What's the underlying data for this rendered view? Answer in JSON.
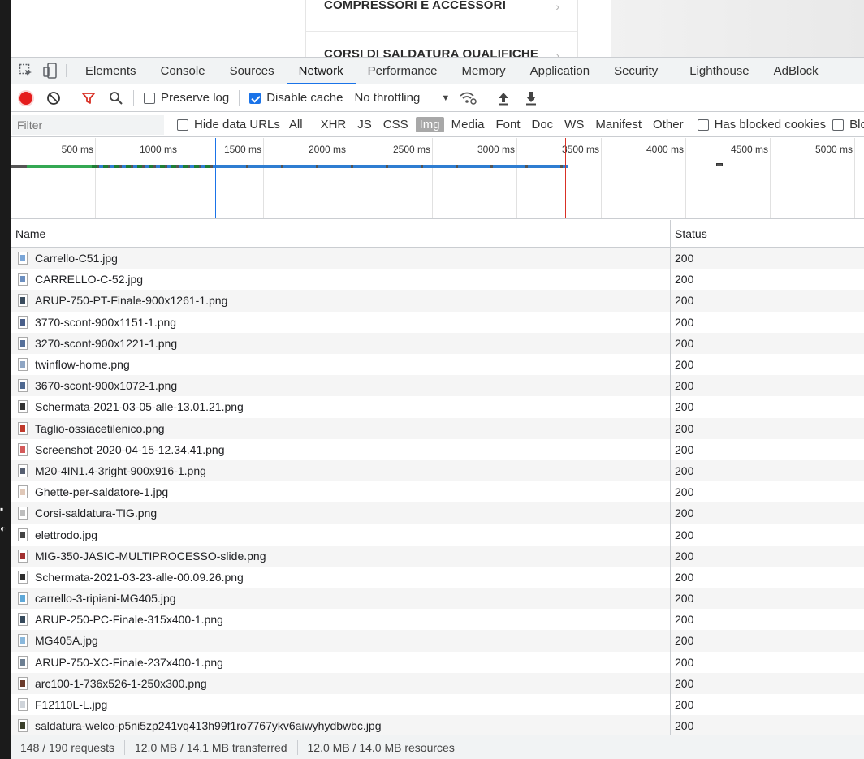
{
  "page": {
    "menu_items": [
      "COMPRESSORI E ACCESSORI",
      "CORSI DI SALDATURA QUALIFICHE"
    ]
  },
  "tabs": [
    "Elements",
    "Console",
    "Sources",
    "Network",
    "Performance",
    "Memory",
    "Application",
    "Security",
    "Lighthouse",
    "AdBlock"
  ],
  "active_tab": "Network",
  "toolbar": {
    "preserve_log": "Preserve log",
    "preserve_log_checked": false,
    "disable_cache": "Disable cache",
    "disable_cache_checked": true,
    "throttling": "No throttling"
  },
  "filterbar": {
    "placeholder": "Filter",
    "hide_data_urls": "Hide data URLs",
    "types": [
      "All",
      "XHR",
      "JS",
      "CSS",
      "Img",
      "Media",
      "Font",
      "Doc",
      "WS",
      "Manifest",
      "Other"
    ],
    "active_type": "Img",
    "has_blocked_cookies": "Has blocked cookies",
    "blocked_truncated": "Bloc"
  },
  "overview": {
    "ticks": [
      "500 ms",
      "1000 ms",
      "1500 ms",
      "2000 ms",
      "2500 ms",
      "3000 ms",
      "3500 ms",
      "4000 ms",
      "4500 ms",
      "5000 ms"
    ]
  },
  "table": {
    "headers": {
      "name": "Name",
      "status": "Status"
    },
    "rows": [
      {
        "name": "Carrello-C51.jpg",
        "status": "200",
        "color": "#7aa6d8"
      },
      {
        "name": "CARRELLO-C-52.jpg",
        "status": "200",
        "color": "#6c8fc0"
      },
      {
        "name": "ARUP-750-PT-Finale-900x1261-1.png",
        "status": "200",
        "color": "#3a4c5e"
      },
      {
        "name": "3770-scont-900x1151-1.png",
        "status": "200",
        "color": "#4a5f8a"
      },
      {
        "name": "3270-scont-900x1221-1.png",
        "status": "200",
        "color": "#56709a"
      },
      {
        "name": "twinflow-home.png",
        "status": "200",
        "color": "#8fa6c4"
      },
      {
        "name": "3670-scont-900x1072-1.png",
        "status": "200",
        "color": "#4e6890"
      },
      {
        "name": "Schermata-2021-03-05-alle-13.01.21.png",
        "status": "200",
        "color": "#333333"
      },
      {
        "name": "Taglio-ossiacetilenico.png",
        "status": "200",
        "color": "#c0392b"
      },
      {
        "name": "Screenshot-2020-04-15-12.34.41.png",
        "status": "200",
        "color": "#d45a5a"
      },
      {
        "name": "M20-4IN1.4-3right-900x916-1.png",
        "status": "200",
        "color": "#555e70"
      },
      {
        "name": "Ghette-per-saldatore-1.jpg",
        "status": "200",
        "color": "#e0c8b8"
      },
      {
        "name": "Corsi-saldatura-TIG.png",
        "status": "200",
        "color": "#bdbdbd"
      },
      {
        "name": "elettrodo.jpg",
        "status": "200",
        "color": "#444444"
      },
      {
        "name": "MIG-350-JASIC-MULTIPROCESSO-slide.png",
        "status": "200",
        "color": "#a23030"
      },
      {
        "name": "Schermata-2021-03-23-alle-00.09.26.png",
        "status": "200",
        "color": "#2e2e2e"
      },
      {
        "name": "carrello-3-ripiani-MG405.jpg",
        "status": "200",
        "color": "#5fa8d8"
      },
      {
        "name": "ARUP-250-PC-Finale-315x400-1.png",
        "status": "200",
        "color": "#364a5c"
      },
      {
        "name": "MG405A.jpg",
        "status": "200",
        "color": "#8ab8dc"
      },
      {
        "name": "ARUP-750-XC-Finale-237x400-1.png",
        "status": "200",
        "color": "#6d7f92"
      },
      {
        "name": "arc100-1-736x526-1-250x300.png",
        "status": "200",
        "color": "#6b3b2b"
      },
      {
        "name": "F12110L-L.jpg",
        "status": "200",
        "color": "#cfd4da"
      },
      {
        "name": "saldatura-welco-p5ni5zp241vq413h99f1ro7767ykv6aiwyhydbwbc.jpg",
        "status": "200",
        "color": "#3a3f2a"
      }
    ]
  },
  "statusbar": {
    "requests": "148 / 190 requests",
    "transferred": "12.0 MB / 14.1 MB transferred",
    "resources": "12.0 MB / 14.0 MB resources"
  },
  "colors": {
    "accent": "#1a73e8",
    "record": "#e51d1d",
    "filter_icon": "#d93025"
  }
}
